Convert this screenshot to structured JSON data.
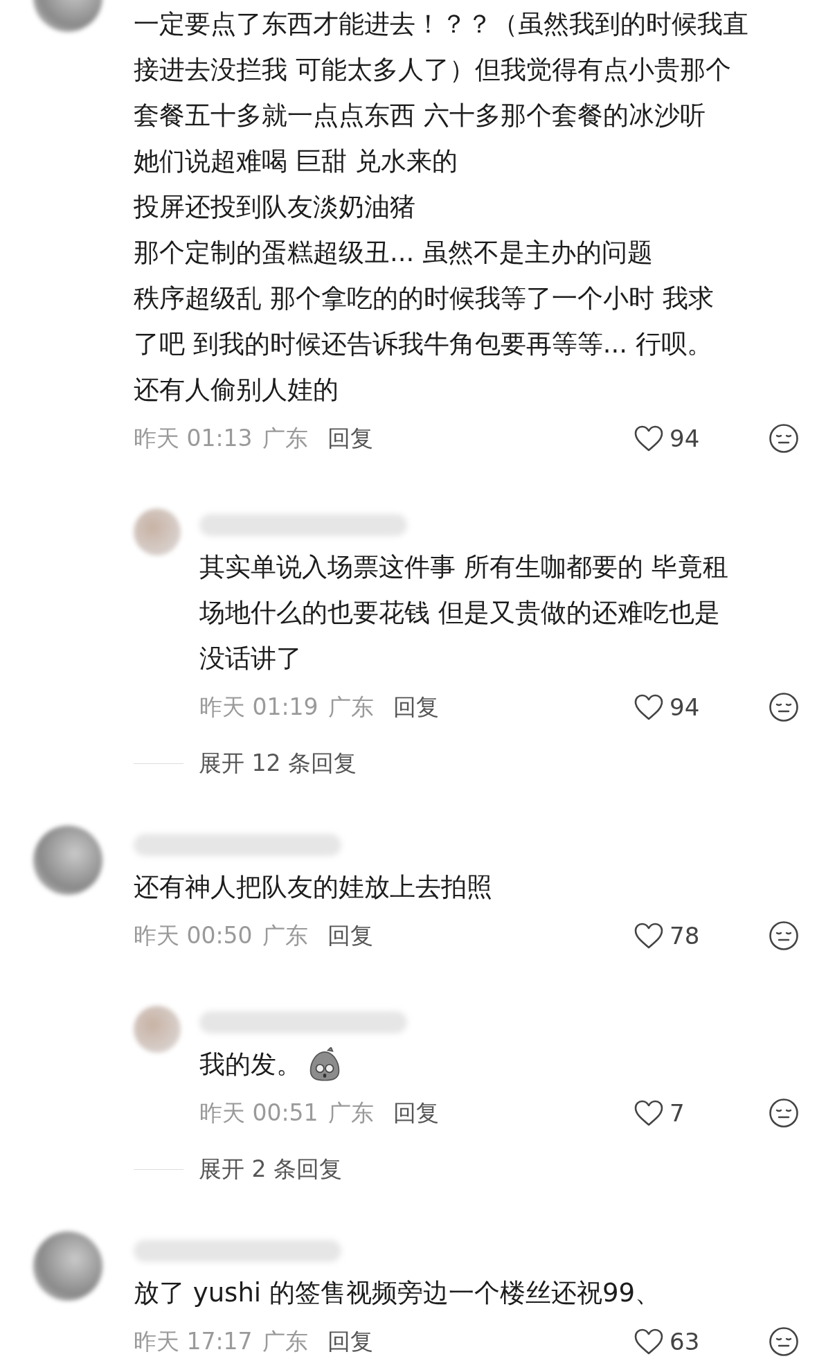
{
  "comments": [
    {
      "kind": "comment",
      "lines": [
        "一定要点了东西才能进去！？？（虽然我到的时候我直",
        "接进去没拦我 可能太多人了）但我觉得有点小贵那个",
        "套餐五十多就一点点东西 六十多那个套餐的冰沙听",
        "她们说超难喝 巨甜 兑水来的",
        "投屏还投到队友淡奶油猪",
        "那个定制的蛋糕超级丑... 虽然不是主办的问题",
        "秩序超级乱 那个拿吃的的时候我等了一个小时 我求",
        "了吧 到我的时候还告诉我牛角包要再等等... 行呗。",
        "还有人偷别人娃的"
      ],
      "sticker": false,
      "time": "昨天 01:13",
      "location": "广东",
      "reply": "回复",
      "likes": "94"
    },
    {
      "kind": "reply",
      "lines": [
        "其实单说入场票这件事 所有生咖都要的 毕竟租",
        "场地什么的也要花钱 但是又贵做的还难吃也是",
        "没话讲了"
      ],
      "sticker": false,
      "time": "昨天 01:19",
      "location": "广东",
      "reply": "回复",
      "likes": "94",
      "expand": "展开 12 条回复"
    },
    {
      "kind": "comment",
      "lines": [
        "还有神人把队友的娃放上去拍照"
      ],
      "sticker": false,
      "time": "昨天 00:50",
      "location": "广东",
      "reply": "回复",
      "likes": "78"
    },
    {
      "kind": "reply",
      "lines": [
        "我的发。"
      ],
      "sticker": true,
      "time": "昨天 00:51",
      "location": "广东",
      "reply": "回复",
      "likes": "7",
      "expand": "展开 2 条回复"
    },
    {
      "kind": "comment",
      "lines": [
        "放了 yushi 的签售视频旁边一个楼丝还祝99、"
      ],
      "sticker": false,
      "time": "昨天 17:17",
      "location": "广东",
      "reply": "回复",
      "likes": "63"
    }
  ]
}
